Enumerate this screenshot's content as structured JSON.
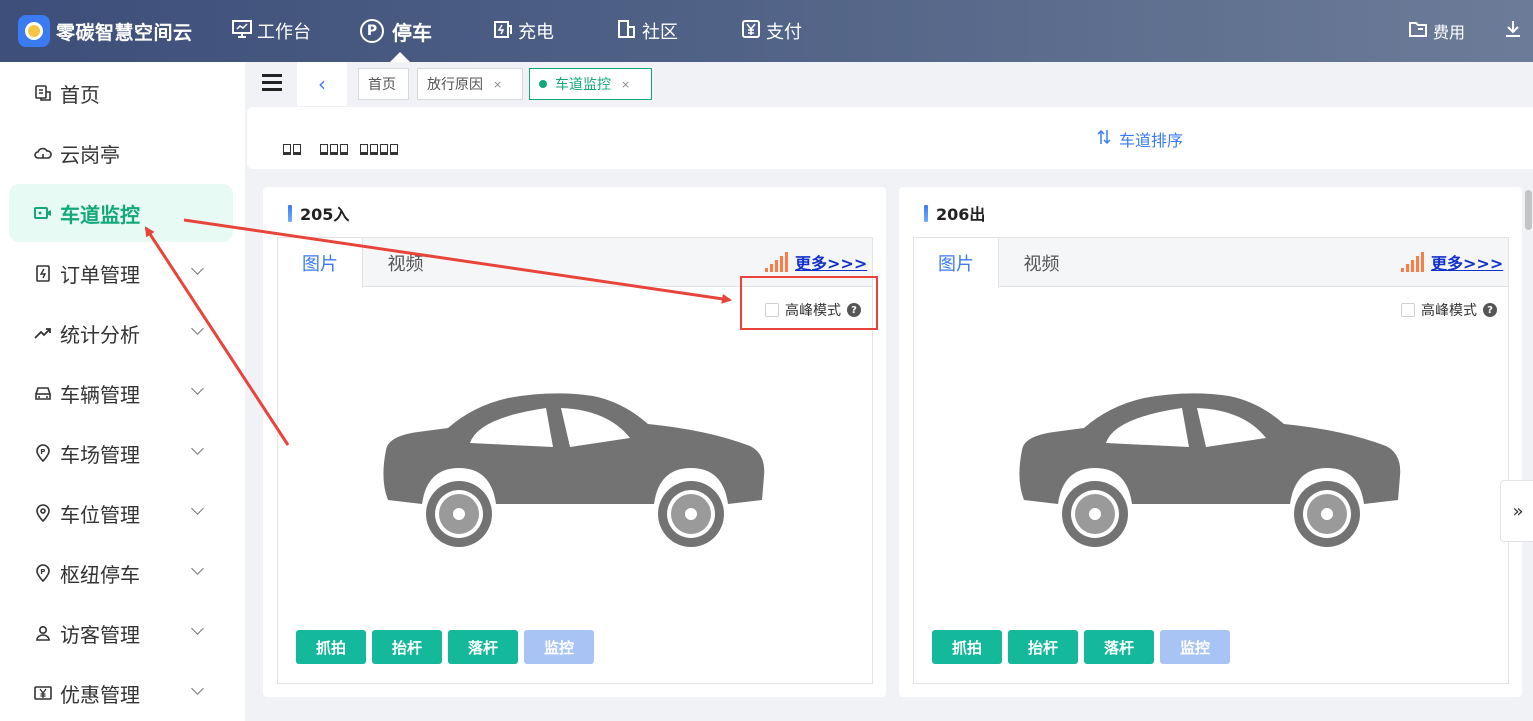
{
  "app": {
    "name": "零碳智慧空间云"
  },
  "topnav": {
    "items": [
      {
        "label": "工作台",
        "icon": "monitor-icon"
      },
      {
        "label": "停车",
        "icon": "parking-pin-icon",
        "active": true
      },
      {
        "label": "充电",
        "icon": "charge-icon"
      },
      {
        "label": "社区",
        "icon": "building-icon"
      },
      {
        "label": "支付",
        "icon": "yuan-icon"
      }
    ],
    "fee": {
      "label": "费用",
      "icon": "folder-icon"
    },
    "download_icon": "download-icon"
  },
  "sidebar": {
    "items": [
      {
        "label": "首页",
        "icon": "home-device-icon"
      },
      {
        "label": "云岗亭",
        "icon": "cloud-icon"
      },
      {
        "label": "车道监控",
        "icon": "video-icon",
        "active": true
      },
      {
        "label": "订单管理",
        "icon": "order-icon",
        "expandable": true
      },
      {
        "label": "统计分析",
        "icon": "trend-icon",
        "expandable": true
      },
      {
        "label": "车辆管理",
        "icon": "car-icon",
        "expandable": true
      },
      {
        "label": "车场管理",
        "icon": "parking-icon",
        "expandable": true
      },
      {
        "label": "车位管理",
        "icon": "location-icon",
        "expandable": true
      },
      {
        "label": "枢纽停车",
        "icon": "parking-icon",
        "expandable": true
      },
      {
        "label": "访客管理",
        "icon": "user-icon",
        "expandable": true
      },
      {
        "label": "优惠管理",
        "icon": "coupon-icon",
        "expandable": true
      }
    ]
  },
  "tabs": [
    {
      "label": "首页"
    },
    {
      "label": "放行原因",
      "close": "×"
    },
    {
      "label": "车道监控",
      "close": "×",
      "active": true
    }
  ],
  "toolbar": {
    "sort_label": "车道排序",
    "sort_icon": "sort-icon"
  },
  "lanes": [
    {
      "title": "205入",
      "tab_image": "图片",
      "tab_video": "视频",
      "more": "更多>>>",
      "peak_label": "高峰模式",
      "peak_checked": false,
      "buttons": {
        "capture": "抓拍",
        "raise": "抬杆",
        "lower": "落杆",
        "monitor": "监控"
      }
    },
    {
      "title": "206出",
      "tab_image": "图片",
      "tab_video": "视频",
      "more": "更多>>>",
      "peak_label": "高峰模式",
      "peak_checked": false,
      "buttons": {
        "capture": "抓拍",
        "raise": "抬杆",
        "lower": "落杆",
        "monitor": "监控"
      }
    }
  ],
  "colors": {
    "accent": "#12a87a",
    "primary": "#3b7bf2",
    "button": "#13b99a",
    "annotation": "#e8443a"
  }
}
